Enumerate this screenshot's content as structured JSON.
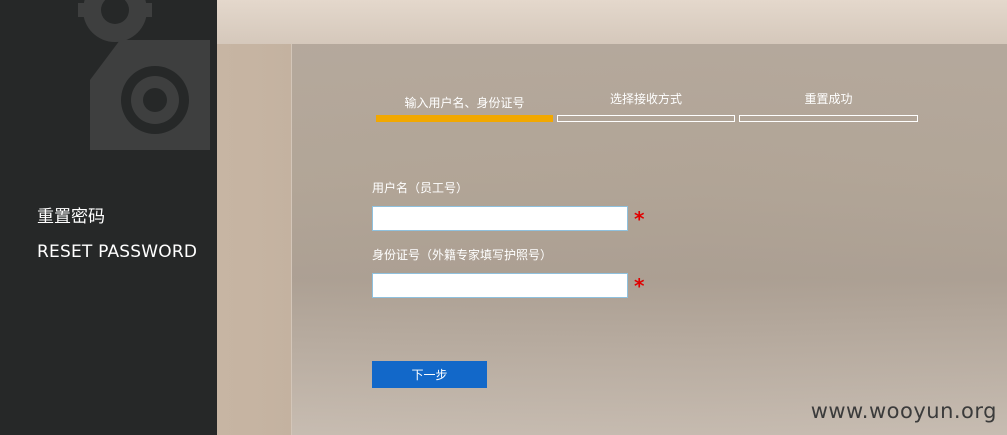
{
  "sidebar": {
    "title": "重置密码",
    "subtitle": "RESET PASSWORD"
  },
  "steps": [
    {
      "label": "输入用户名、身份证号",
      "active": true
    },
    {
      "label": "选择接收方式",
      "active": false
    },
    {
      "label": "重置成功",
      "active": false
    }
  ],
  "form": {
    "username_label": "用户名（员工号）",
    "username_value": "",
    "id_label": "身份证号（外籍专家填写护照号）",
    "id_value": "",
    "required_mark": "*",
    "next_label": "下一步"
  },
  "watermark": "www.wooyun.org",
  "colors": {
    "sidebar_bg": "#262828",
    "active_step": "#f2a800",
    "button": "#1268c9",
    "required": "#e00000"
  }
}
